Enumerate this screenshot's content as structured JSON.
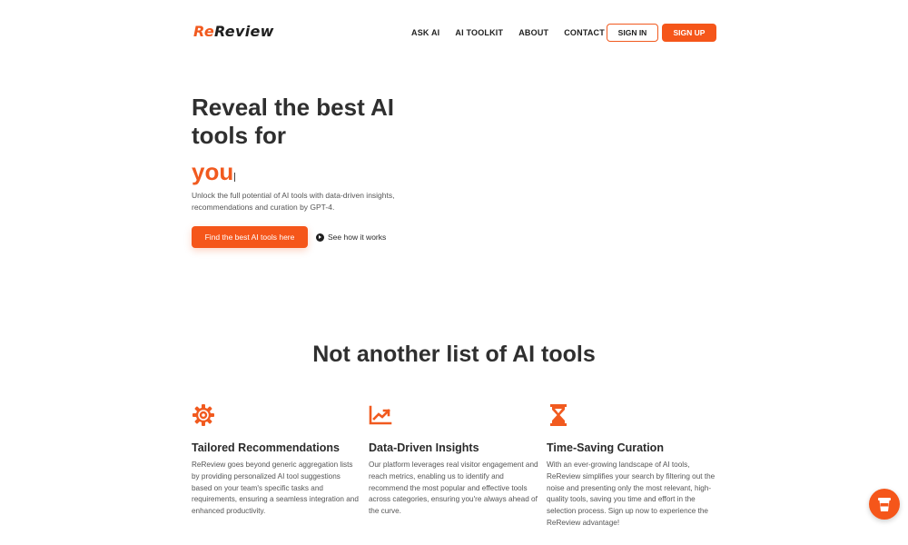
{
  "brand": {
    "logo_prefix": "Re",
    "logo_suffix": "Review",
    "accent_color": "#f15a1f"
  },
  "nav": {
    "items": [
      {
        "label": "ASK AI"
      },
      {
        "label": "AI TOOLKIT"
      },
      {
        "label": "ABOUT"
      },
      {
        "label": "CONTACT"
      }
    ],
    "sign_in": "SIGN IN",
    "sign_up": "SIGN UP"
  },
  "hero": {
    "title": "Reveal the best AI tools for",
    "highlight": "you",
    "subtitle": "Unlock the full potential of AI tools with data-driven insights, recommendations and curation by GPT-4.",
    "cta_label": "Find the best AI tools here",
    "secondary_label": "See how it works"
  },
  "section": {
    "title": "Not another list of AI tools",
    "features": [
      {
        "icon": "gear-icon",
        "title": "Tailored Recommendations",
        "text": "ReReview goes beyond generic aggregation lists by providing personalized AI tool suggestions based on your team's specific tasks and requirements, ensuring a seamless integration and enhanced productivity."
      },
      {
        "icon": "chart-up-icon",
        "title": "Data-Driven Insights",
        "text": "Our platform leverages real visitor engagement and reach metrics, enabling us to identify and recommend the most popular and effective tools across categories, ensuring you're always ahead of the curve."
      },
      {
        "icon": "hourglass-icon",
        "title": "Time-Saving Curation",
        "text": "With an ever-growing landscape of AI tools, ReReview simplifies your search by filtering out the noise and presenting only the most relevant, high-quality tools, saving you time and effort in the selection process. Sign up now to experience the ReReview advantage!"
      }
    ]
  },
  "fab": {
    "icon": "coffee-cup-icon"
  }
}
